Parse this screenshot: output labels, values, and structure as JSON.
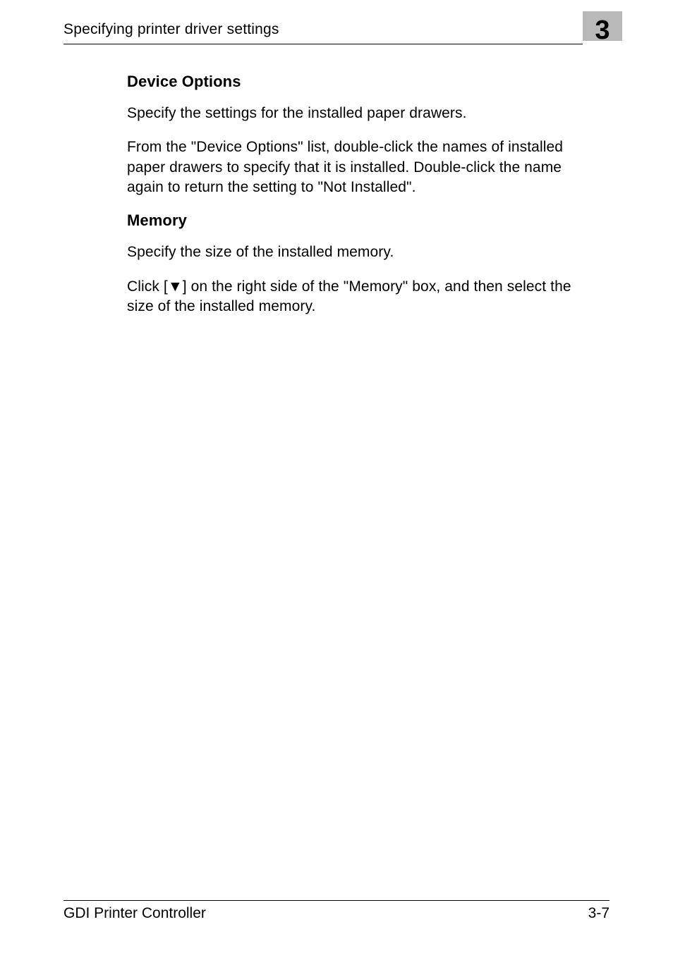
{
  "header": {
    "title": "Specifying printer driver settings",
    "chapter_number": "3"
  },
  "sections": {
    "device_options": {
      "heading": "Device Options",
      "para1": "Specify the settings for the installed paper drawers.",
      "para2": "From the \"Device Options\" list, double-click the names of installed paper drawers to specify that it is installed. Double-click the name again to return the setting to \"Not Installed\"."
    },
    "memory": {
      "heading": "Memory",
      "para1": "Specify the size of the installed memory.",
      "para2_prefix": "Click [",
      "para2_triangle": "▼",
      "para2_suffix": "] on the right side of the \"Memory\" box, and then select the size of the installed memory."
    }
  },
  "footer": {
    "left": "GDI Printer Controller",
    "right": "3-7"
  }
}
